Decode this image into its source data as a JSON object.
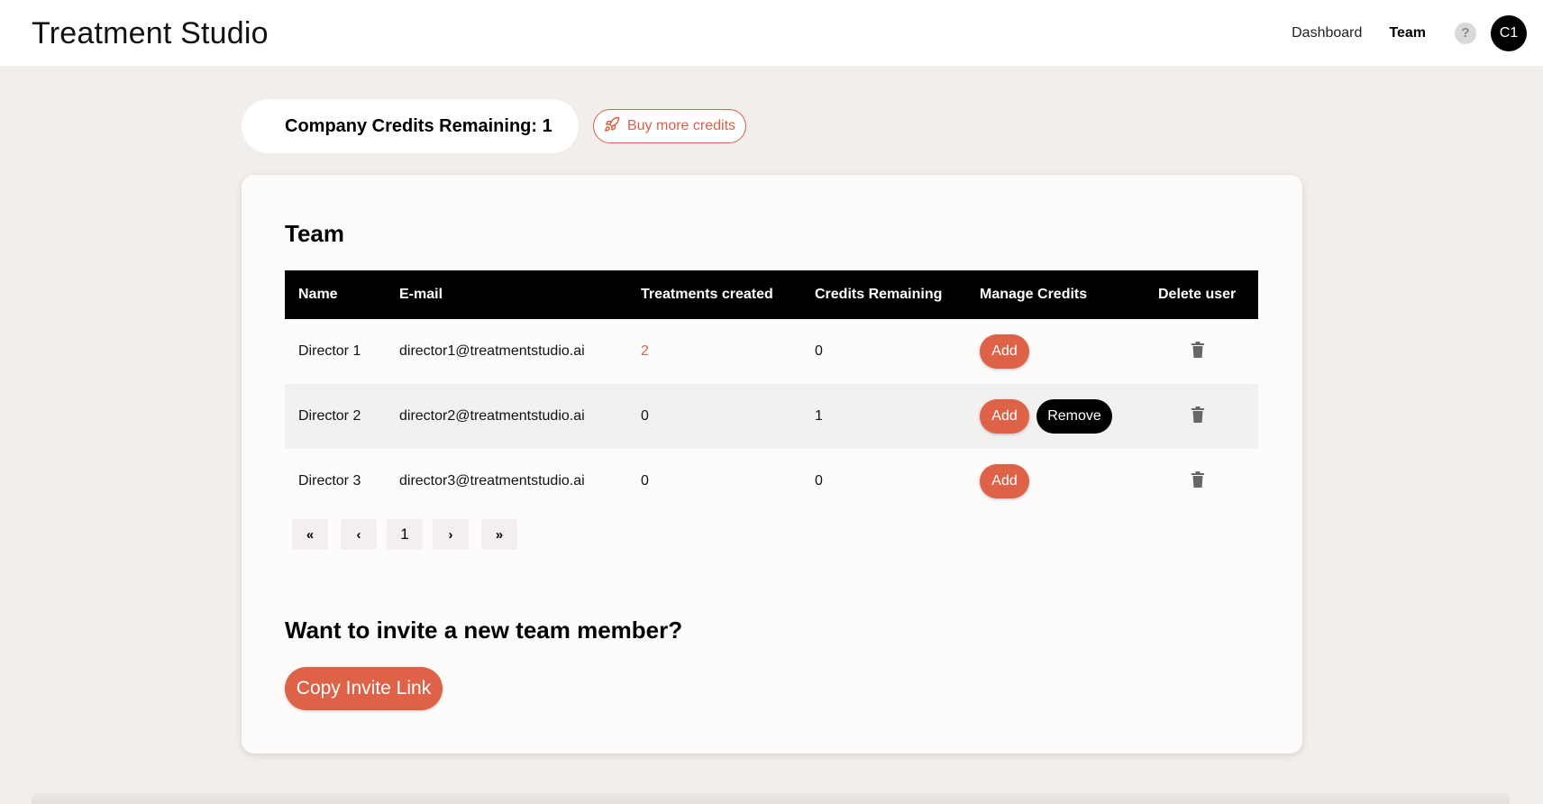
{
  "header": {
    "app_title": "Treatment Studio",
    "nav": [
      {
        "label": "Dashboard",
        "active": false
      },
      {
        "label": "Team",
        "active": true
      }
    ],
    "help_label": "?",
    "avatar_initials": "C1"
  },
  "credits": {
    "label": "Company Credits Remaining: 1",
    "buy_label": "Buy more credits",
    "buy_icon": "rocket-icon"
  },
  "team": {
    "title": "Team",
    "columns": [
      "Name",
      "E-mail",
      "Treatments created",
      "Credits Remaining",
      "Manage Credits",
      "Delete user"
    ],
    "rows": [
      {
        "name": "Director 1",
        "email": "director1@treatmentstudio.ai",
        "treatments": "2",
        "credits": "0",
        "add_label": "Add",
        "remove_label": ""
      },
      {
        "name": "Director 2",
        "email": "director2@treatmentstudio.ai",
        "treatments": "0",
        "credits": "1",
        "add_label": "Add",
        "remove_label": "Remove"
      },
      {
        "name": "Director 3",
        "email": "director3@treatmentstudio.ai",
        "treatments": "0",
        "credits": "0",
        "add_label": "Add",
        "remove_label": ""
      }
    ],
    "delete_icon": "trash-icon",
    "pagination": {
      "first": "«",
      "prev": "‹",
      "page": "1",
      "next": "›",
      "last": "»"
    }
  },
  "invite": {
    "title": "Want to invite a new team member?",
    "button_label": "Copy Invite Link"
  },
  "colors": {
    "accent": "#dd6248",
    "background": "#f2eeeb",
    "header_row": "#000000"
  }
}
